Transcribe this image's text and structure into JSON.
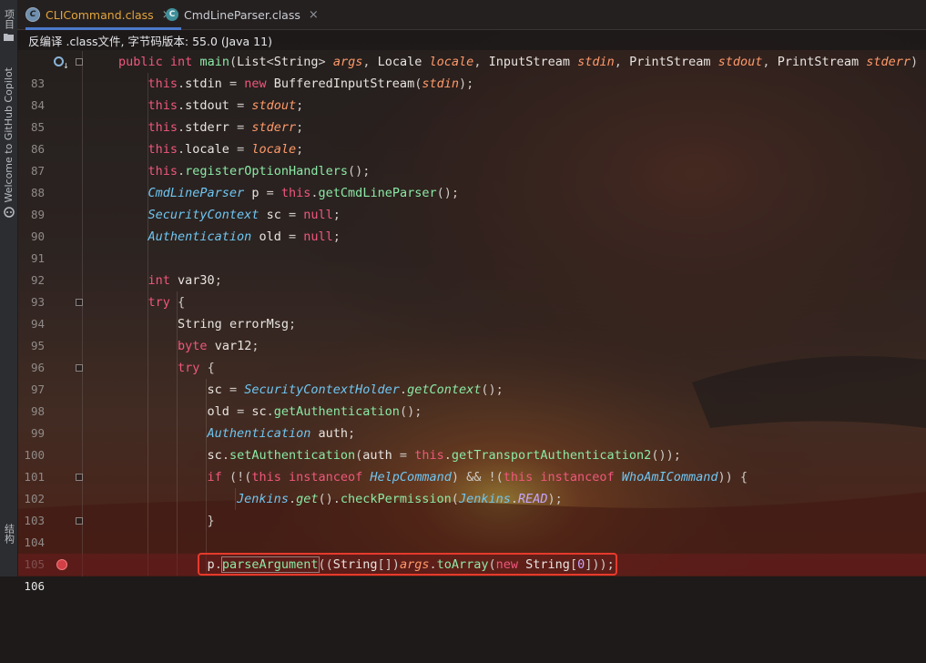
{
  "left_strip": {
    "project_label": "项目",
    "copilot_label": "Welcome to GitHub Copilot",
    "structure_label": "结构"
  },
  "tabs": [
    {
      "label": "CLICommand.class",
      "active": true,
      "icon": "class-file-icon"
    },
    {
      "label": "CmdLineParser.class",
      "active": false,
      "icon": "class-file-icon"
    }
  ],
  "notice": "反编译 .class文件, 字节码版本: 55.0 (Java 11)",
  "lines": [
    {
      "num": "83"
    },
    {
      "num": "84"
    },
    {
      "num": "85"
    },
    {
      "num": "86"
    },
    {
      "num": "87"
    },
    {
      "num": "88"
    },
    {
      "num": "89"
    },
    {
      "num": "90"
    },
    {
      "num": "91"
    },
    {
      "num": "92"
    },
    {
      "num": "93"
    },
    {
      "num": "94"
    },
    {
      "num": "95"
    },
    {
      "num": "96"
    },
    {
      "num": "97"
    },
    {
      "num": "98"
    },
    {
      "num": "99"
    },
    {
      "num": "100"
    },
    {
      "num": "101"
    },
    {
      "num": "102"
    },
    {
      "num": "103"
    },
    {
      "num": "104"
    },
    {
      "num": "105"
    },
    {
      "num": "106"
    }
  ],
  "code": {
    "l83": [
      "public",
      "int",
      "main",
      "List",
      "String",
      "args",
      "Locale",
      "locale",
      "InputStream",
      "stdin",
      "PrintStream",
      "stdout",
      "PrintStream",
      "stderr"
    ],
    "l84": [
      "this",
      "stdin",
      "new",
      "BufferedInputStream",
      "stdin"
    ],
    "l85": [
      "this",
      "stdout",
      "stdout"
    ],
    "l86": [
      "this",
      "stderr",
      "stderr"
    ],
    "l87": [
      "this",
      "locale",
      "locale"
    ],
    "l88": [
      "this",
      "registerOptionHandlers"
    ],
    "l89": [
      "CmdLineParser",
      "p",
      "this",
      "getCmdLineParser"
    ],
    "l90": [
      "SecurityContext",
      "sc",
      "null"
    ],
    "l91": [
      "Authentication",
      "old",
      "null"
    ],
    "l93": [
      "int",
      "var30"
    ],
    "l94": [
      "try"
    ],
    "l95": [
      "String",
      "errorMsg"
    ],
    "l96": [
      "byte",
      "var12"
    ],
    "l97": [
      "try"
    ],
    "l98": [
      "sc",
      "SecurityContextHolder",
      "getContext"
    ],
    "l99": [
      "old",
      "sc",
      "getAuthentication"
    ],
    "l100": [
      "Authentication",
      "auth"
    ],
    "l101": [
      "sc",
      "setAuthentication",
      "auth",
      "this",
      "getTransportAuthentication2"
    ],
    "l102": [
      "if",
      "this",
      "instanceof",
      "HelpCommand",
      "this",
      "instanceof",
      "WhoAmICommand"
    ],
    "l103": [
      "Jenkins",
      "get",
      "checkPermission",
      "Jenkins",
      "READ"
    ],
    "l106": [
      "p",
      "parseArgument",
      "String",
      "args",
      "toArray",
      "new",
      "String",
      "0"
    ]
  }
}
